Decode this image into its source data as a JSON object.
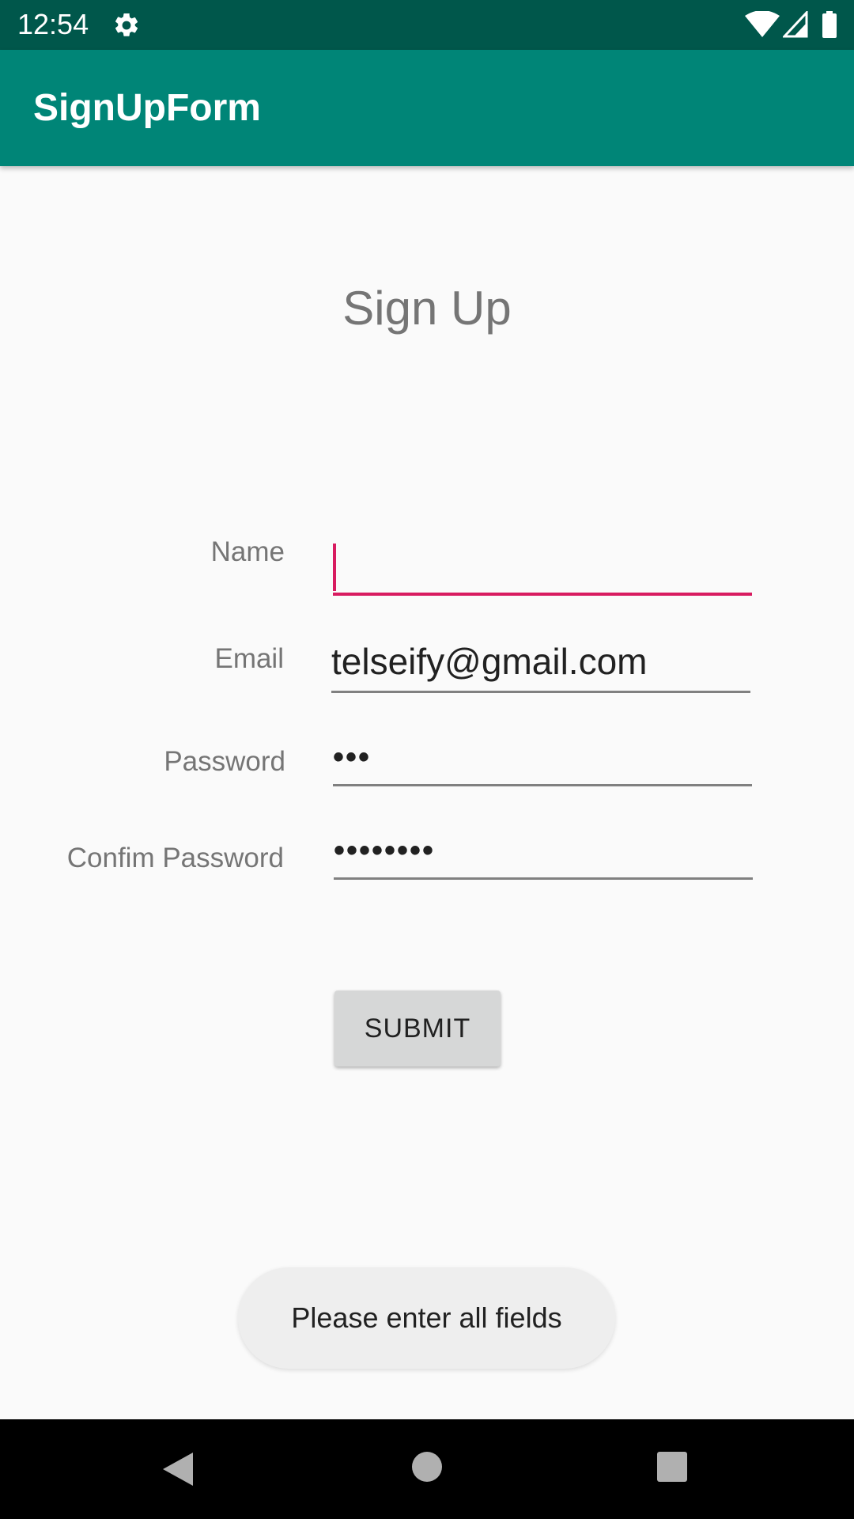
{
  "status_bar": {
    "time": "12:54",
    "icons": [
      "gear-icon",
      "wifi-icon",
      "cell-signal-icon",
      "battery-icon"
    ]
  },
  "app_bar": {
    "title": "SignUpForm",
    "color": "#008577"
  },
  "form": {
    "heading": "Sign Up",
    "fields": [
      {
        "label": "Name",
        "value": "",
        "focused": true
      },
      {
        "label": "Email",
        "value": "telseify@gmail.com",
        "focused": false
      },
      {
        "label": "Password",
        "value": "•••",
        "focused": false
      },
      {
        "label": "Confim Password",
        "value": "••••••••",
        "focused": false
      }
    ],
    "submit_label": "SUBMIT",
    "accent_color": "#d81b60"
  },
  "toast": {
    "message": "Please enter all fields"
  },
  "nav_bar": {
    "icons": [
      "back-icon",
      "home-icon",
      "recents-icon"
    ]
  }
}
